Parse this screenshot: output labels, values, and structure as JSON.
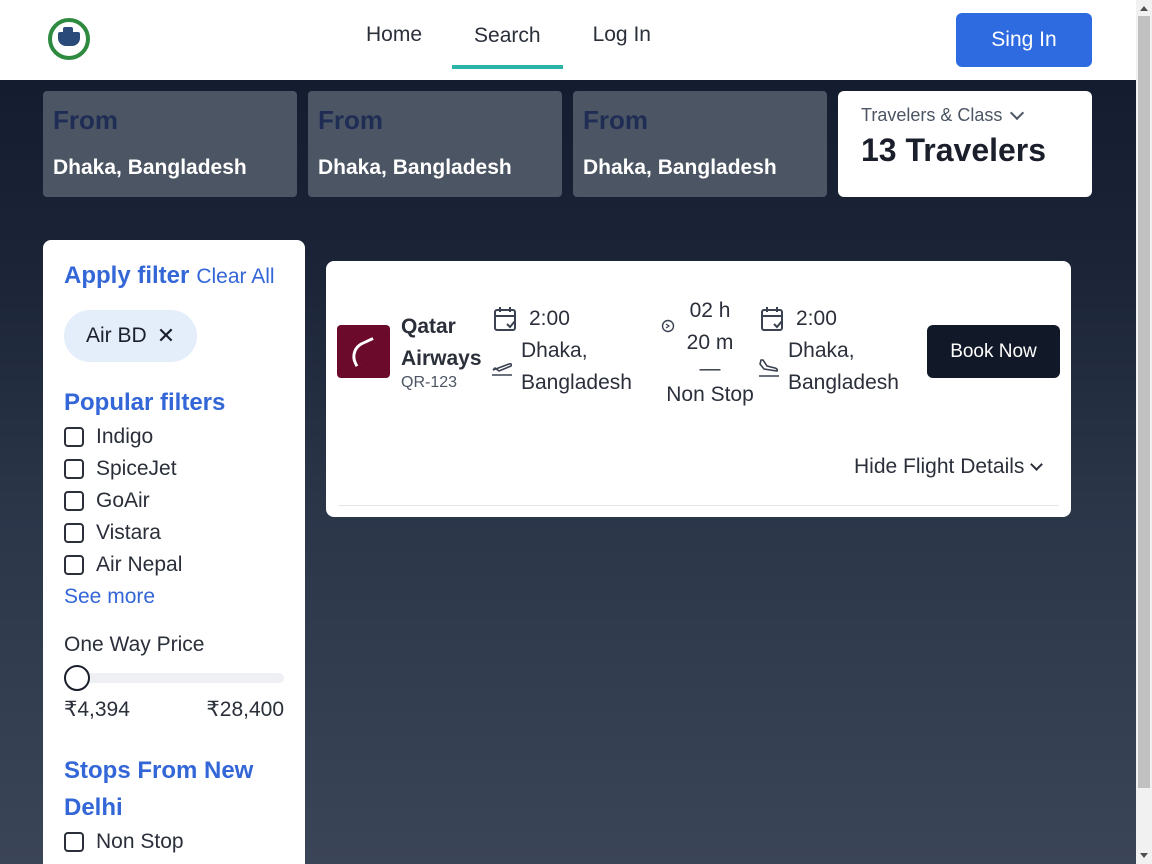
{
  "header": {
    "logo_icon": "ship-logo-icon",
    "nav": [
      {
        "label": "Home",
        "active": false
      },
      {
        "label": "Search",
        "active": true
      },
      {
        "label": "Log In",
        "active": false
      }
    ],
    "signin_label": "Sing In"
  },
  "search": {
    "from_boxes": [
      {
        "label": "From",
        "value": "Dhaka, Bangladesh"
      },
      {
        "label": "From",
        "value": "Dhaka, Bangladesh"
      },
      {
        "label": "From",
        "value": "Dhaka, Bangladesh"
      }
    ],
    "travelers": {
      "label": "Travelers & Class",
      "value": "13 Travelers"
    }
  },
  "filters": {
    "title": "Apply filter",
    "clear_all": "Clear All",
    "chip": {
      "label": "Air BD",
      "close": "✕"
    },
    "popular_title": "Popular filters",
    "popular": [
      "Indigo",
      "SpiceJet",
      "GoAir",
      "Vistara",
      "Air Nepal"
    ],
    "see_more": "See more",
    "price_label": "One Way Price",
    "price_min": "₹4,394",
    "price_max": "₹28,400",
    "price_position": 0,
    "stops_title": "Stops From New Delhi",
    "stops": [
      "Non Stop"
    ]
  },
  "flight": {
    "airline": "Qatar Airways",
    "code": "QR-123",
    "departure": {
      "time": "2:00",
      "place": "Dhaka, Bangladesh"
    },
    "duration": {
      "hours": "02 h",
      "minutes": "20 m",
      "dash": "—",
      "stops": "Non Stop"
    },
    "arrival": {
      "time": "2:00",
      "place": "Dhaka, Bangladesh"
    },
    "book_label": "Book Now",
    "hide_details": "Hide Flight Details"
  },
  "colors": {
    "primary": "#2f6be0",
    "accent_underline": "#2ab3a6",
    "filter_blue": "#3366d6",
    "airline_brand": "#6b0a2b"
  }
}
